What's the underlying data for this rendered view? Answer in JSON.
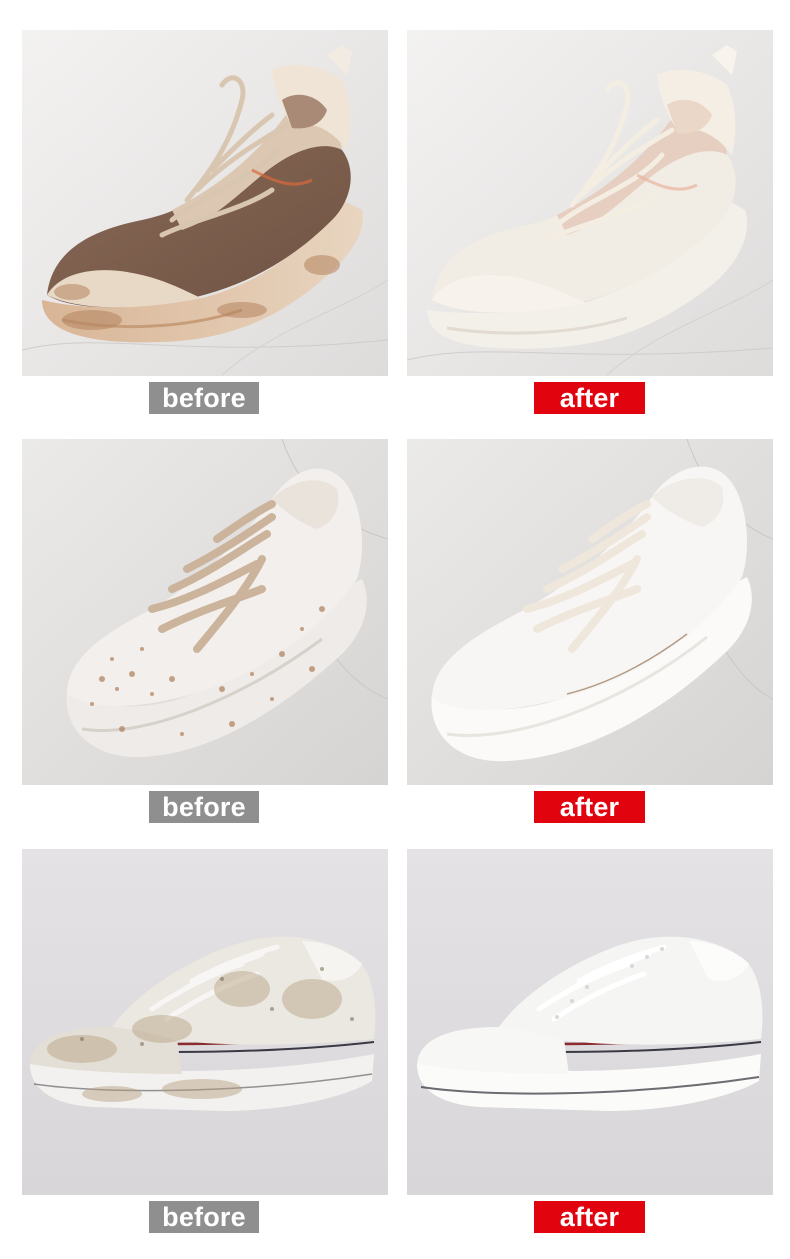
{
  "colors": {
    "before_badge": "#8f8f8f",
    "after_badge": "#e1030d",
    "badge_text": "#ffffff",
    "page_background": "#ffffff"
  },
  "rows": [
    {
      "shoe": "chunky-sneaker",
      "before": {
        "label": "before",
        "state": "dirty"
      },
      "after": {
        "label": "after",
        "state": "clean"
      }
    },
    {
      "shoe": "white-leather-sneaker",
      "before": {
        "label": "before",
        "state": "dirty"
      },
      "after": {
        "label": "after",
        "state": "clean"
      }
    },
    {
      "shoe": "canvas-low-top",
      "before": {
        "label": "before",
        "state": "dirty"
      },
      "after": {
        "label": "after",
        "state": "clean"
      }
    }
  ]
}
